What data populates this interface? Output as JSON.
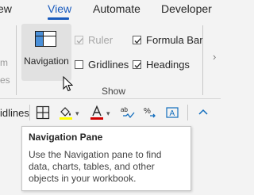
{
  "tabs": [
    {
      "label": "ew",
      "active": false
    },
    {
      "label": "View",
      "active": true
    },
    {
      "label": "Automate",
      "active": false
    },
    {
      "label": "Developer",
      "active": false
    }
  ],
  "ribbon": {
    "previous_group_fragment": [
      "m",
      "es"
    ],
    "navigation_button_label": "Navigation",
    "checkboxes": [
      {
        "label": "Ruler",
        "checked": true,
        "enabled": false
      },
      {
        "label": "Gridlines",
        "checked": false,
        "enabled": true
      },
      {
        "label": "Formula Bar",
        "checked": true,
        "enabled": true
      },
      {
        "label": "Headings",
        "checked": true,
        "enabled": true
      }
    ],
    "group_label": "Show"
  },
  "toolbar": {
    "truncated_label": "idlines",
    "icons": [
      "borders-icon",
      "fill-color-icon",
      "font-color-icon",
      "spelling-icon",
      "percent-format-icon",
      "format-shape-icon",
      "collapse-icon"
    ]
  },
  "tooltip": {
    "title": "Navigation Pane",
    "body": "Use the Navigation pane to find data, charts, tables, and other objects in your workbook."
  },
  "colors": {
    "accent": "#185abd",
    "fill_highlight": "#ffff00",
    "font_color": "#d10000",
    "icon_blue": "#0f6cbd"
  }
}
